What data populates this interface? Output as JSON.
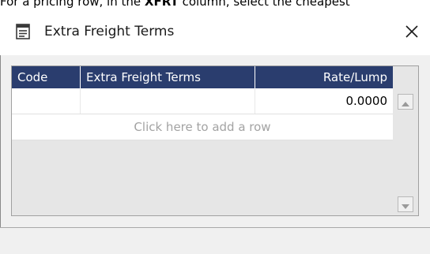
{
  "caption": {
    "prefix": "For a pricing row, in the ",
    "bold": "XFRT",
    "suffix": " column, select the cheapest"
  },
  "dialog": {
    "title": "Extra Freight Terms",
    "title_icon": "document-list-icon",
    "close_label": "✕"
  },
  "grid": {
    "columns": [
      "Code",
      "Extra Freight Terms",
      "Rate/Lump"
    ],
    "rows": [
      {
        "code": "",
        "terms": "",
        "rate": "0.0000"
      }
    ],
    "add_row_text": "Click here to add a row"
  },
  "colors": {
    "header_bg": "#2a3d6e",
    "header_text": "#ffffff",
    "placeholder_text": "#a3a3a3",
    "grid_bg": "#e6e6e6",
    "client_bg": "#f0f0f0"
  }
}
